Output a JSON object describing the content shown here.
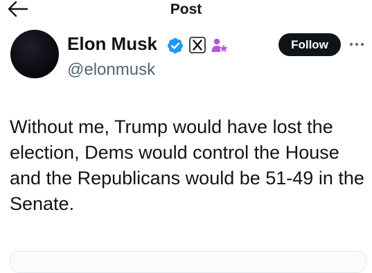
{
  "header": {
    "title": "Post",
    "back_icon": "arrow-left-icon"
  },
  "author": {
    "name": "Elon Musk",
    "handle": "@elonmusk",
    "badges": [
      "verified-badge-icon",
      "x-logo-icon",
      "affiliate-person-icon"
    ]
  },
  "actions": {
    "follow_label": "Follow",
    "more_icon": "more-dots-icon"
  },
  "tweet": {
    "text": "Without me, Trump would have lost the election, Dems would control the House and the Republicans would be 51-49 in the Senate."
  },
  "colors": {
    "text_primary": "#0f1419",
    "text_secondary": "#536471",
    "verified_blue": "#1d9bf0",
    "affiliate_purple": "#b35ad6",
    "follow_bg": "#0f1419"
  }
}
